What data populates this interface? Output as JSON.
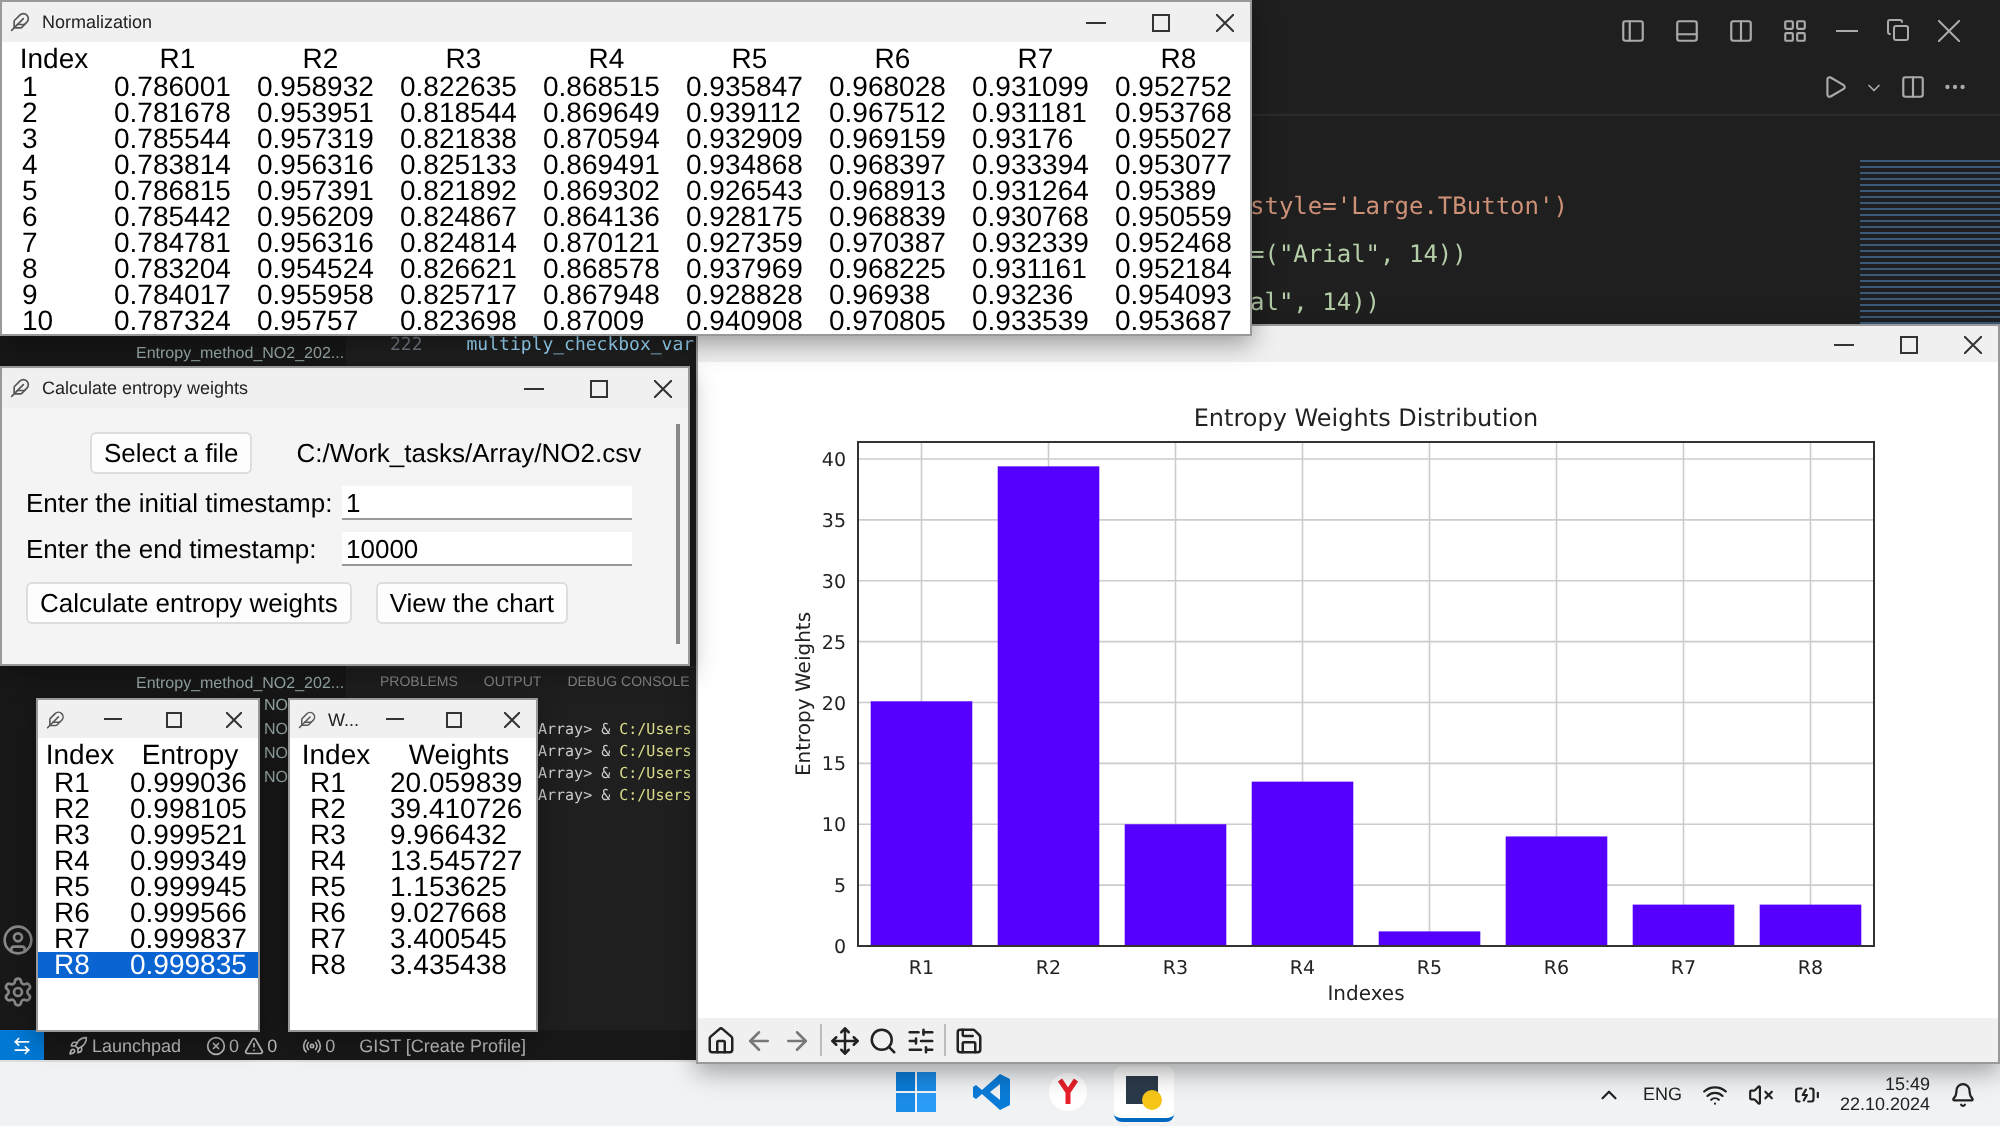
{
  "editor": {
    "explorer_top": [
      "Entropy_method_NO2_202..."
    ],
    "explorer_bottom": [
      {
        "kind": "file",
        "text": "Entropy_method_NO2_202..."
      },
      {
        "kind": "fragment",
        "text": "NO"
      },
      {
        "kind": "fragment",
        "text": "NO"
      },
      {
        "kind": "fragment",
        "text": "NO"
      },
      {
        "kind": "fragment",
        "text": "NO"
      }
    ],
    "line_number": "222",
    "line_code": "multiply_checkbox_var",
    "code_tails": [
      {
        "kind": "call",
        "text": "style='Large.TButton')"
      },
      {
        "kind": "font",
        "text": "=(\"Arial\", 14))"
      },
      {
        "kind": "font",
        "text": "al\", 14))"
      }
    ],
    "panel_tabs": [
      "PROBLEMS",
      "OUTPUT",
      "DEBUG CONSOLE"
    ],
    "terminal_lines": [
      {
        "prompt": "Array> &",
        "path": "C:/Users"
      },
      {
        "prompt": "Array> &",
        "path": "C:/Users"
      },
      {
        "prompt": "Array> &",
        "path": "C:/Users"
      },
      {
        "prompt": "Array> &",
        "path": "C:/Users"
      }
    ],
    "status_bar": {
      "launchpad": "Launchpad",
      "errors": "0",
      "warnings": "0",
      "ports": "0",
      "profile": "GIST [Create Profile]"
    }
  },
  "normalization": {
    "title": "Normalization",
    "columns": [
      "Index",
      "R1",
      "R2",
      "R3",
      "R4",
      "R5",
      "R6",
      "R7",
      "R8"
    ],
    "rows": [
      [
        "1",
        "0.786001",
        "0.958932",
        "0.822635",
        "0.868515",
        "0.935847",
        "0.968028",
        "0.931099",
        "0.952752"
      ],
      [
        "2",
        "0.781678",
        "0.953951",
        "0.818544",
        "0.869649",
        "0.939112",
        "0.967512",
        "0.931181",
        "0.953768"
      ],
      [
        "3",
        "0.785544",
        "0.957319",
        "0.821838",
        "0.870594",
        "0.932909",
        "0.969159",
        "0.93176",
        "0.955027"
      ],
      [
        "4",
        "0.783814",
        "0.956316",
        "0.825133",
        "0.869491",
        "0.934868",
        "0.968397",
        "0.933394",
        "0.953077"
      ],
      [
        "5",
        "0.786815",
        "0.957391",
        "0.821892",
        "0.869302",
        "0.926543",
        "0.968913",
        "0.931264",
        "0.95389"
      ],
      [
        "6",
        "0.785442",
        "0.956209",
        "0.824867",
        "0.864136",
        "0.928175",
        "0.968839",
        "0.930768",
        "0.950559"
      ],
      [
        "7",
        "0.784781",
        "0.956316",
        "0.824814",
        "0.870121",
        "0.927359",
        "0.970387",
        "0.932339",
        "0.952468"
      ],
      [
        "8",
        "0.783204",
        "0.954524",
        "0.826621",
        "0.868578",
        "0.937969",
        "0.968225",
        "0.931161",
        "0.952184"
      ],
      [
        "9",
        "0.784017",
        "0.955958",
        "0.825717",
        "0.867948",
        "0.928828",
        "0.96938",
        "0.93236",
        "0.954093"
      ],
      [
        "10",
        "0.787324",
        "0.95757",
        "0.823698",
        "0.87009",
        "0.940908",
        "0.970805",
        "0.933539",
        "0.953687"
      ]
    ]
  },
  "calculator": {
    "title": "Calculate entropy weights",
    "select_button": "Select a file",
    "file_path": "C:/Work_tasks/Array/NO2.csv",
    "fields": [
      {
        "label": "Enter the initial timestamp:",
        "value": "1"
      },
      {
        "label": "Enter the end timestamp:",
        "value": "10000"
      }
    ],
    "buttons": [
      "Calculate entropy weights",
      "View the chart"
    ]
  },
  "entropy": {
    "columns": [
      "Index",
      "Entropy"
    ],
    "rows": [
      {
        "cells": [
          "R1",
          "0.999036"
        ],
        "selected": false
      },
      {
        "cells": [
          "R2",
          "0.998105"
        ],
        "selected": false
      },
      {
        "cells": [
          "R3",
          "0.999521"
        ],
        "selected": false
      },
      {
        "cells": [
          "R4",
          "0.999349"
        ],
        "selected": false
      },
      {
        "cells": [
          "R5",
          "0.999945"
        ],
        "selected": false
      },
      {
        "cells": [
          "R6",
          "0.999566"
        ],
        "selected": false
      },
      {
        "cells": [
          "R7",
          "0.999837"
        ],
        "selected": false
      },
      {
        "cells": [
          "R8",
          "0.999835"
        ],
        "selected": true
      }
    ]
  },
  "weights": {
    "title": "W...",
    "columns": [
      "Index",
      "Weights"
    ],
    "rows": [
      {
        "cells": [
          "R1",
          "20.059839"
        ],
        "selected": false
      },
      {
        "cells": [
          "R2",
          "39.410726"
        ],
        "selected": false
      },
      {
        "cells": [
          "R3",
          "9.966432"
        ],
        "selected": false
      },
      {
        "cells": [
          "R4",
          "13.545727"
        ],
        "selected": false
      },
      {
        "cells": [
          "R5",
          "1.153625"
        ],
        "selected": false
      },
      {
        "cells": [
          "R6",
          "9.027668"
        ],
        "selected": false
      },
      {
        "cells": [
          "R7",
          "3.400545"
        ],
        "selected": false
      },
      {
        "cells": [
          "R8",
          "3.435438"
        ],
        "selected": false
      }
    ]
  },
  "chart_window": {
    "chart_data": {
      "type": "bar",
      "title": "Entropy Weights Distribution",
      "xlabel": "Indexes",
      "ylabel": "Entropy Weights",
      "categories": [
        "R1",
        "R2",
        "R3",
        "R4",
        "R5",
        "R6",
        "R7",
        "R8"
      ],
      "series": [
        {
          "color": "#5500ff",
          "values": [
            20.1,
            39.4,
            10.0,
            13.5,
            1.2,
            9.0,
            3.4,
            3.4
          ]
        }
      ],
      "ylim": [
        0,
        41.4
      ],
      "yticks": [
        0,
        5,
        10,
        15,
        20,
        25,
        30,
        35,
        40
      ],
      "grid": true
    }
  },
  "taskbar": {
    "apps": [
      {
        "kind": "start",
        "selected": false
      },
      {
        "kind": "vscode",
        "selected": false
      },
      {
        "kind": "browser",
        "selected": false
      },
      {
        "kind": "python",
        "selected": true
      }
    ],
    "language": "ENG",
    "time": "15:49",
    "date": "22.10.2024"
  }
}
